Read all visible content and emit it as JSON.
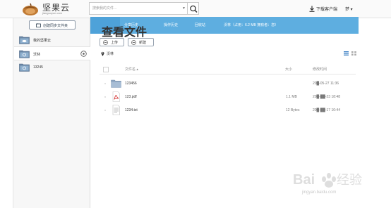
{
  "header": {
    "app_name": "坚果云",
    "app_domain": "jianguoyun.com",
    "search_placeholder": "搜索我的文件...",
    "download_label": "下载客户端",
    "user_label": "梦 ▾",
    "brand_color": "#5eaee0"
  },
  "sidebar": {
    "new_sync_label": "创建同步文件夹",
    "items": [
      {
        "label": "我的坚果云",
        "icon": "cloud-folder-icon"
      },
      {
        "label": "沃林",
        "icon": "sync-folder-icon"
      },
      {
        "label": "13245",
        "icon": "sync-folder-icon"
      }
    ]
  },
  "nav": {
    "tabs": [
      "查看文件",
      "分享历史",
      "操作历史",
      "回收站"
    ],
    "usage": "沃林（占用：6.2 MB  拥有者：您）"
  },
  "toolbar": {
    "upload_label": "上传",
    "new_label": "新建"
  },
  "breadcrumb": {
    "current": "沃林"
  },
  "list": {
    "headers": {
      "name": "文件名 ▴",
      "size": "大小",
      "date": "修改时间"
    },
    "rows": [
      {
        "name": "123456",
        "size": "",
        "date": "20█-05-27 11:36",
        "type": "folder"
      },
      {
        "name": "123.pdf",
        "size": "1.1 MB",
        "date": "20█-██-23 18:48",
        "type": "pdf"
      },
      {
        "name": "1234.txt",
        "size": "12 Bytes",
        "date": "20█-██-17 10:44",
        "type": "txt"
      }
    ]
  },
  "watermark": {
    "text": "Baidu 经验",
    "url": "jingyan.baidu.com"
  }
}
